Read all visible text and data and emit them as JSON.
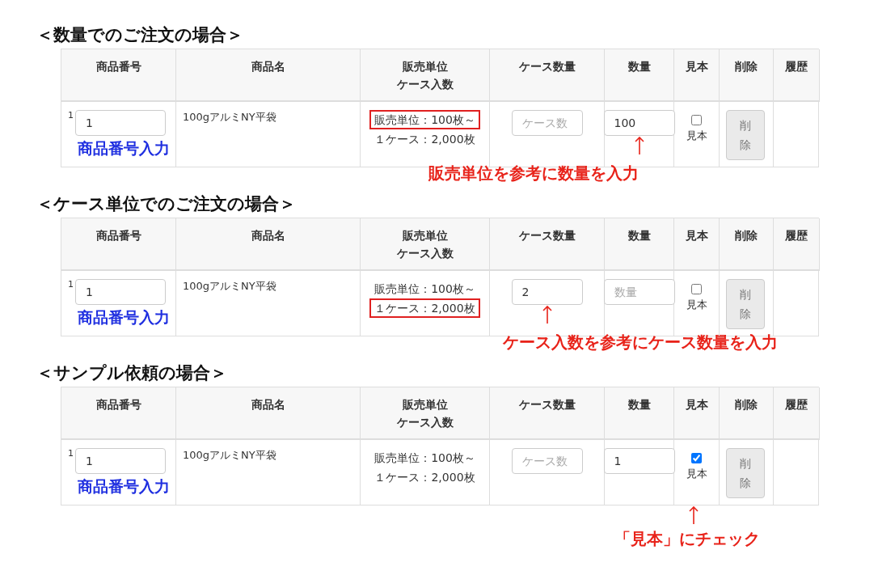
{
  "sections": [
    {
      "heading": "＜数量でのご注文の場合＞",
      "columns": [
        {
          "lines": [
            "商品番号"
          ]
        },
        {
          "lines": [
            "商品名"
          ]
        },
        {
          "lines": [
            "販売単位",
            "ケース入数"
          ]
        },
        {
          "lines": [
            "ケース数量"
          ]
        },
        {
          "lines": [
            "数量"
          ]
        },
        {
          "lines": [
            "見本"
          ]
        },
        {
          "lines": [
            "削除"
          ]
        },
        {
          "lines": [
            "履歴"
          ]
        }
      ],
      "row": {
        "index": "1",
        "product_number": "1",
        "product_number_note": "商品番号入力",
        "product_name": "100gアルミNY平袋",
        "unit_lines": [
          {
            "text": "販売単位：100枚～",
            "highlighted": true
          },
          {
            "text": "１ケース：2,000枚",
            "highlighted": false
          }
        ],
        "case_quantity": {
          "placeholder": "ケース数"
        },
        "quantity": {
          "value": "100"
        },
        "sample": {
          "checked": false,
          "label": "見本"
        },
        "delete": "削除"
      },
      "note": {
        "kind": "quantity",
        "text": "販売単位を参考に数量を入力"
      }
    },
    {
      "heading": "＜ケース単位でのご注文の場合＞",
      "columns": [
        {
          "lines": [
            "商品番号"
          ]
        },
        {
          "lines": [
            "商品名"
          ]
        },
        {
          "lines": [
            "販売単位",
            "ケース入数"
          ]
        },
        {
          "lines": [
            "ケース数量"
          ]
        },
        {
          "lines": [
            "数量"
          ]
        },
        {
          "lines": [
            "見本"
          ]
        },
        {
          "lines": [
            "削除"
          ]
        },
        {
          "lines": [
            "履歴"
          ]
        }
      ],
      "row": {
        "index": "1",
        "product_number": "1",
        "product_number_note": "商品番号入力",
        "product_name": "100gアルミNY平袋",
        "unit_lines": [
          {
            "text": "販売単位：100枚～",
            "highlighted": false
          },
          {
            "text": "１ケース：2,000枚",
            "highlighted": true
          }
        ],
        "case_quantity": {
          "value": "2"
        },
        "quantity": {
          "placeholder": "数量"
        },
        "sample": {
          "checked": false,
          "label": "見本"
        },
        "delete": "削除"
      },
      "note": {
        "kind": "case_quantity",
        "text": "ケース入数を参考にケース数量を入力"
      }
    },
    {
      "heading": "＜サンプル依頼の場合＞",
      "columns": [
        {
          "lines": [
            "商品番号"
          ]
        },
        {
          "lines": [
            "商品名"
          ]
        },
        {
          "lines": [
            "販売単位",
            "ケース入数"
          ]
        },
        {
          "lines": [
            "ケース数量"
          ]
        },
        {
          "lines": [
            "数量"
          ]
        },
        {
          "lines": [
            "見本"
          ]
        },
        {
          "lines": [
            "削除"
          ]
        },
        {
          "lines": [
            "履歴"
          ]
        }
      ],
      "row": {
        "index": "1",
        "product_number": "1",
        "product_number_note": "商品番号入力",
        "product_name": "100gアルミNY平袋",
        "unit_lines": [
          {
            "text": "販売単位：100枚～",
            "highlighted": false
          },
          {
            "text": "１ケース：2,000枚",
            "highlighted": false
          }
        ],
        "case_quantity": {
          "placeholder": "ケース数"
        },
        "quantity": {
          "value": "1"
        },
        "sample": {
          "checked": true,
          "label": "見本"
        },
        "delete": "削除"
      },
      "note": {
        "kind": "sample",
        "text": "「見本」にチェック"
      }
    }
  ]
}
